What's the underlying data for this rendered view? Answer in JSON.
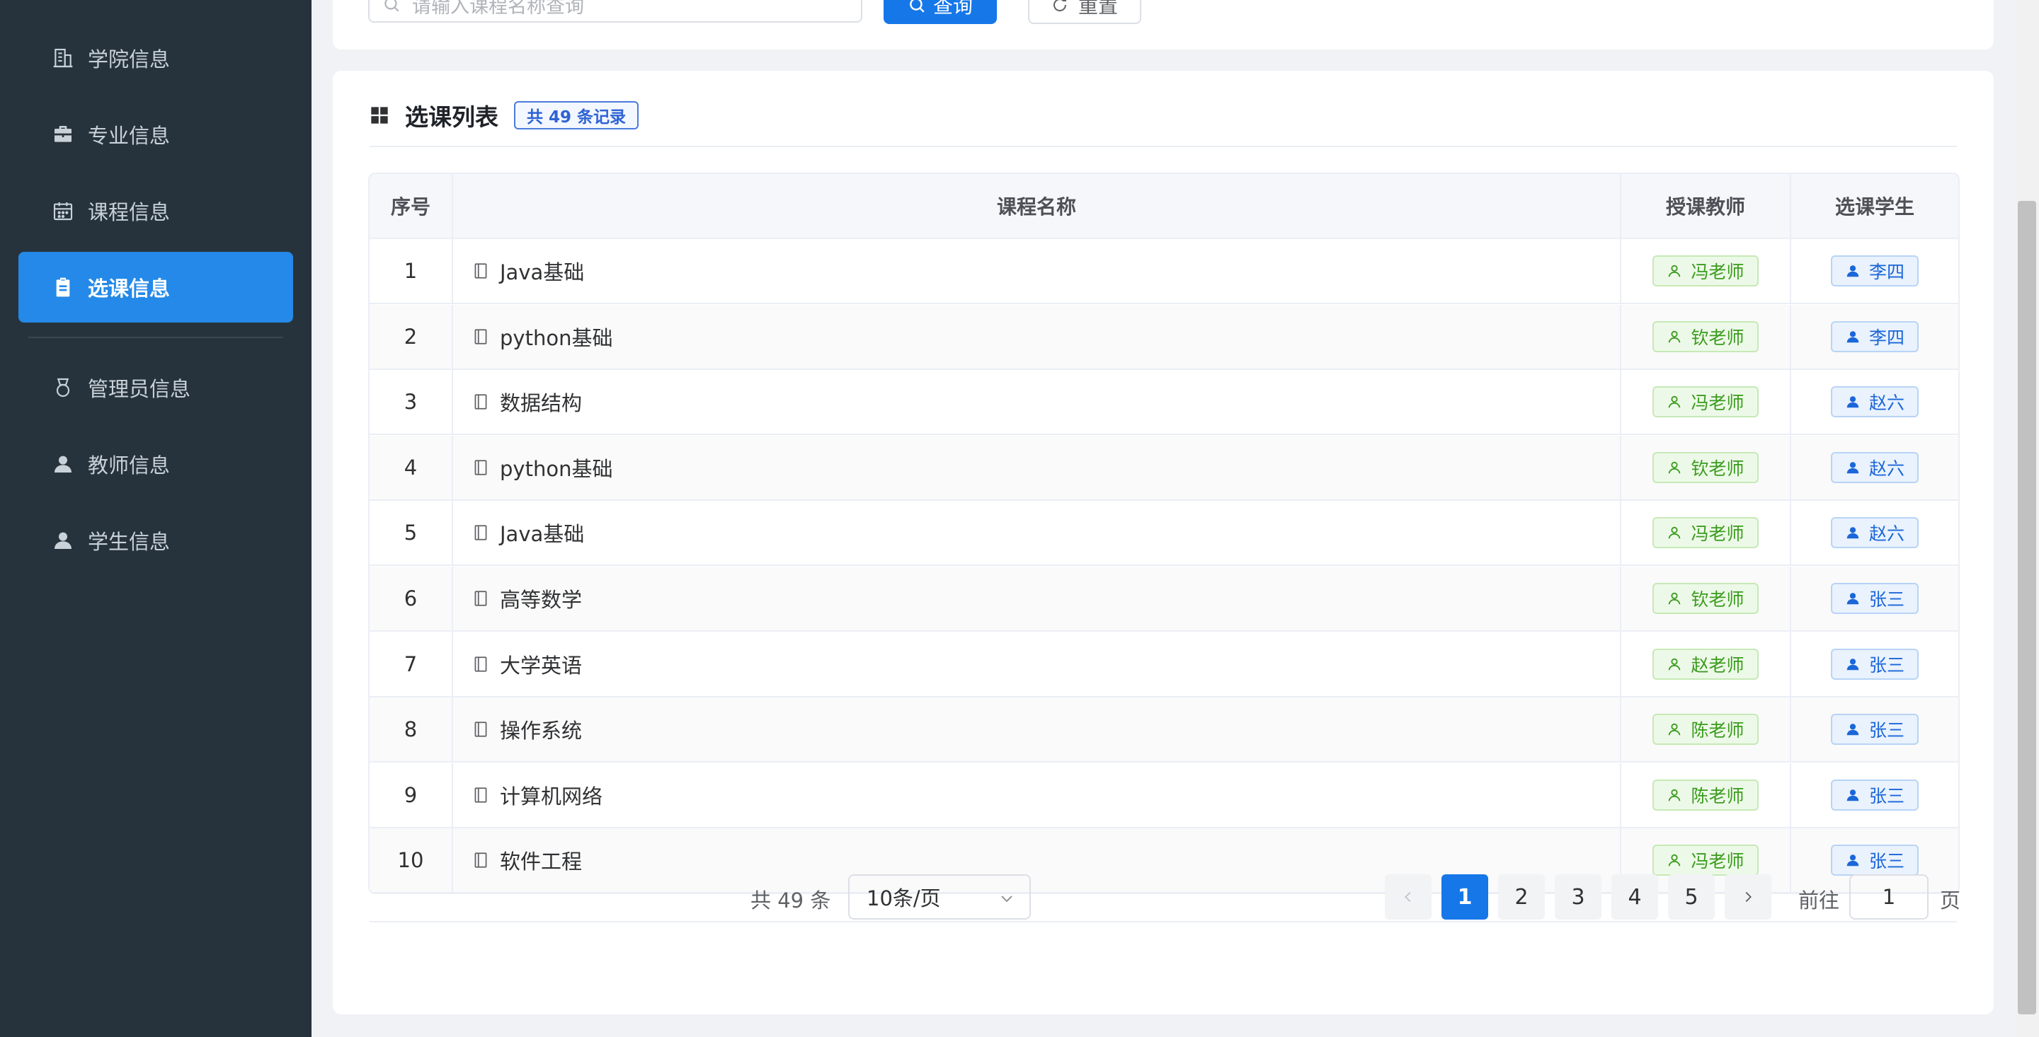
{
  "sidebar": {
    "items": [
      {
        "label": "学院信息",
        "icon": "building-icon"
      },
      {
        "label": "专业信息",
        "icon": "briefcase-icon"
      },
      {
        "label": "课程信息",
        "icon": "calendar-icon"
      },
      {
        "label": "选课信息",
        "icon": "clipboard-icon",
        "active": true
      },
      {
        "label": "管理员信息",
        "icon": "medal-icon"
      },
      {
        "label": "教师信息",
        "icon": "user-icon"
      },
      {
        "label": "学生信息",
        "icon": "user-icon"
      }
    ]
  },
  "search": {
    "placeholder": "请输入课程名称查询",
    "query_label": "查询",
    "reset_label": "重置"
  },
  "list": {
    "title": "选课列表",
    "count_badge": "共 49 条记录",
    "columns": [
      "序号",
      "课程名称",
      "授课教师",
      "选课学生"
    ],
    "rows": [
      {
        "no": "1",
        "course": "Java基础",
        "teacher": "冯老师",
        "student": "李四"
      },
      {
        "no": "2",
        "course": "python基础",
        "teacher": "钦老师",
        "student": "李四"
      },
      {
        "no": "3",
        "course": "数据结构",
        "teacher": "冯老师",
        "student": "赵六"
      },
      {
        "no": "4",
        "course": "python基础",
        "teacher": "钦老师",
        "student": "赵六"
      },
      {
        "no": "5",
        "course": "Java基础",
        "teacher": "冯老师",
        "student": "赵六"
      },
      {
        "no": "6",
        "course": "高等数学",
        "teacher": "钦老师",
        "student": "张三"
      },
      {
        "no": "7",
        "course": "大学英语",
        "teacher": "赵老师",
        "student": "张三"
      },
      {
        "no": "8",
        "course": "操作系统",
        "teacher": "陈老师",
        "student": "张三"
      },
      {
        "no": "9",
        "course": "计算机网络",
        "teacher": "陈老师",
        "student": "张三"
      },
      {
        "no": "10",
        "course": "软件工程",
        "teacher": "冯老师",
        "student": "张三"
      }
    ]
  },
  "pagination": {
    "total": "共 49 条",
    "page_size": "10条/页",
    "pages": [
      "1",
      "2",
      "3",
      "4",
      "5"
    ],
    "current": "1",
    "goto_label": "前往",
    "goto_value": "1",
    "page_unit": "页"
  },
  "colors": {
    "sidebar_bg": "#27333c",
    "active": "#2489e8",
    "primary": "#1677e8",
    "teacher_tag": "#3a9b1d",
    "student_tag": "#1b66d8"
  }
}
